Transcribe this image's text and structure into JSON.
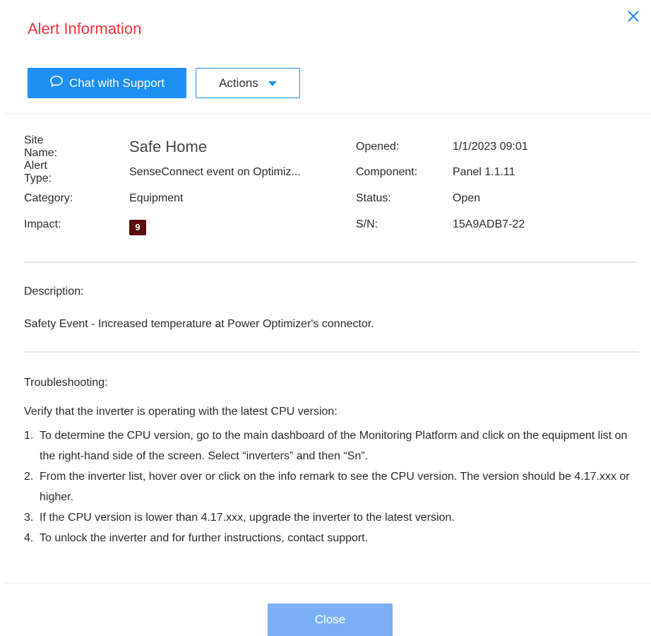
{
  "dialog": {
    "title": "Alert Information",
    "colors": {
      "title": "#f0333b",
      "primary": "#1e8ef2",
      "close_button": "#7bb0f7",
      "impact_badge": "#5a0d0d"
    }
  },
  "toolbar": {
    "chat_label": "Chat with Support",
    "chat_icon": "chat-bubble-icon",
    "actions_label": "Actions",
    "actions_icon": "caret-down-icon"
  },
  "details": {
    "left": [
      {
        "label": "Site Name:",
        "value": "Safe Home"
      },
      {
        "label": "Alert Type:",
        "value": "SenseConnect event on Optimiz..."
      },
      {
        "label": "Category:",
        "value": "Equipment"
      },
      {
        "label": "Impact:",
        "value": "9"
      }
    ],
    "right": [
      {
        "label": "Opened:",
        "value": "1/1/2023 09:01"
      },
      {
        "label": "Component:",
        "value": "Panel 1.1.11"
      },
      {
        "label": "Status:",
        "value": "Open"
      },
      {
        "label": "S/N:",
        "value": "15A9ADB7-22"
      }
    ]
  },
  "description": {
    "label": "Description:",
    "text": "Safety Event - Increased temperature at Power Optimizer's connector."
  },
  "troubleshooting": {
    "label": "Troubleshooting:",
    "intro": "Verify that the inverter is operating with the latest CPU version:",
    "steps": [
      {
        "num": "1.",
        "text": "To determine the CPU version, go to the main dashboard of the Monitoring Platform and click on the equipment list on the right-hand side of the screen. Select “inverters” and then “Sn”."
      },
      {
        "num": "2.",
        "text": "From the inverter list, hover over or click on the info remark to see the CPU version. The version should be 4.17.xxx or higher."
      },
      {
        "num": "3.",
        "text": "If the CPU version is lower than 4.17.xxx, upgrade the inverter to the latest version."
      },
      {
        "num": "4.",
        "text": "To unlock the inverter and for further instructions, contact support."
      }
    ]
  },
  "footer": {
    "close_label": "Close"
  }
}
